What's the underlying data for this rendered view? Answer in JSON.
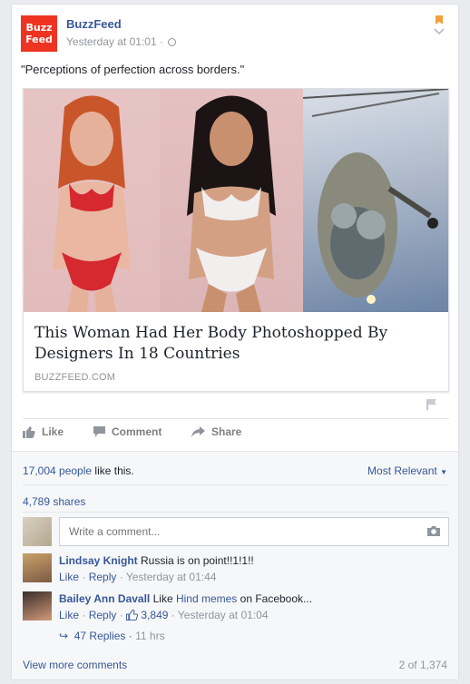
{
  "post": {
    "page_name": "BuzzFeed",
    "logo_text_1": "Buzz",
    "logo_text_2": "Feed",
    "timestamp": "Yesterday at 01:01",
    "separator": "·",
    "text": "\"Perceptions of perfection across borders.\""
  },
  "link": {
    "title": "This Woman Had Her Body Photoshopped By Designers In 18 Countries",
    "domain": "BUZZFEED.COM"
  },
  "actions": {
    "like": "Like",
    "comment": "Comment",
    "share": "Share"
  },
  "feedback": {
    "likes_count": "17,004 people",
    "likes_rest": " like this.",
    "sort": "Most Relevant",
    "shares": "4,789 shares",
    "comment_placeholder": "Write a comment..."
  },
  "comments": [
    {
      "name": "Lindsay Knight",
      "text": "Russia is on point!!1!1!!",
      "like": "Like",
      "reply": "Reply",
      "time": "Yesterday at 01:44"
    },
    {
      "name": "Bailey Ann Davall",
      "text_pre": " Like ",
      "link": "Hind memes",
      "text_post": " on Facebook...",
      "like": "Like",
      "reply": "Reply",
      "like_count": "3,849",
      "time": "Yesterday at 01:04"
    }
  ],
  "replies": {
    "label": "47 Replies",
    "time": "11 hrs"
  },
  "footer": {
    "view_more": "View more comments",
    "count": "2 of 1,374"
  },
  "colors": {
    "brand": "#ee3322",
    "link": "#365899",
    "muted": "#90949c"
  }
}
